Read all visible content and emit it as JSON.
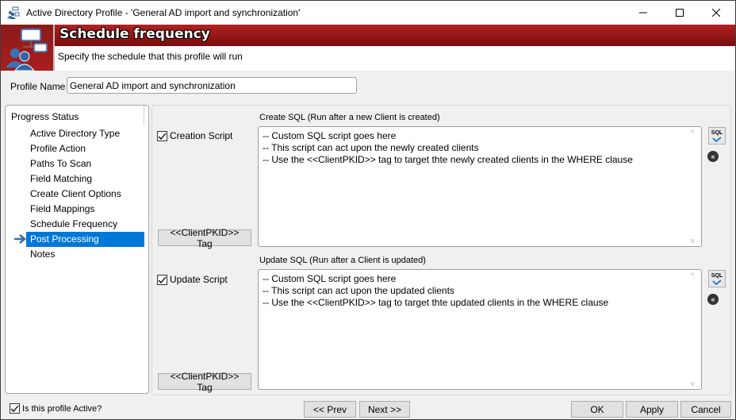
{
  "window": {
    "title": "Active Directory Profile - 'General AD import and synchronization'",
    "controls": {
      "minimize": "—",
      "maximize": "☐",
      "close": "✕"
    }
  },
  "header": {
    "heading": "Schedule frequency",
    "subtitle": "Specify the schedule that this profile will run"
  },
  "profile": {
    "label": "Profile Name",
    "value": "General AD import and synchronization"
  },
  "progress": {
    "title": "Progress Status",
    "items": [
      {
        "label": "Active Directory Type"
      },
      {
        "label": "Profile Action"
      },
      {
        "label": "Paths To Scan"
      },
      {
        "label": "Field Matching"
      },
      {
        "label": "Create Client Options"
      },
      {
        "label": "Field Mappings"
      },
      {
        "label": "Schedule Frequency"
      },
      {
        "label": "Post Processing"
      },
      {
        "label": "Notes"
      }
    ],
    "active_index": 7
  },
  "create": {
    "section_label": "Create SQL (Run after a new Client is created)",
    "checkbox_label": "Creation Script",
    "checked": true,
    "script": "-- Custom SQL script goes here\n-- This script can act upon the newly created clients\n-- Use the <<ClientPKID>> tag to target thte newly created clients in the WHERE clause",
    "tag_button": "<<ClientPKID>> Tag"
  },
  "update": {
    "section_label": "Update SQL (Run after a Client is updated)",
    "checkbox_label": "Update Script",
    "checked": true,
    "script": "-- Custom SQL script goes here\n-- This script can act upon the updated clients\n-- Use the <<ClientPKID>> tag to target thte updated clients in the WHERE clause",
    "tag_button": "<<ClientPKID>> Tag"
  },
  "icons": {
    "sql": "SQL",
    "collapse": "«"
  },
  "footer": {
    "active_label": "Is this profile Active?",
    "active_checked": true,
    "prev": "<< Prev",
    "next": "Next >>",
    "ok": "OK",
    "apply": "Apply",
    "cancel": "Cancel"
  },
  "colors": {
    "accent": "#0078d7",
    "banner": "#8b1a1a"
  }
}
